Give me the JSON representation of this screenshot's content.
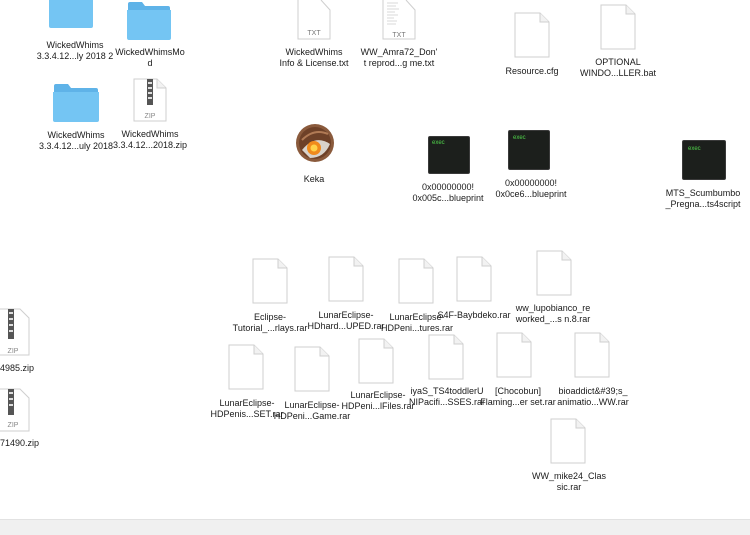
{
  "desktop": {
    "items": [
      {
        "id": "wickedwhims-folder-1",
        "kind": "folder",
        "label": "WickedWhims\n3.3.4.12...ly 2018 2"
      },
      {
        "id": "wickedwhimsmod-folder",
        "kind": "folder",
        "label": "WickedWhimsMo\nd"
      },
      {
        "id": "wickedwhims-folder-2",
        "kind": "folder",
        "label": "WickedWhims\n3.3.4.12...uly 2018"
      },
      {
        "id": "wickedwhims-zip",
        "kind": "zip",
        "badge": "ZIP",
        "label": "WickedWhims\n3.3.4.12...2018.zip"
      },
      {
        "id": "wickedwhims-info-txt",
        "kind": "txt",
        "badge": "TXT",
        "label": "WickedWhims\nInfo & License.txt"
      },
      {
        "id": "ww-amra72-txt",
        "kind": "txt",
        "badge": "TXT",
        "label": "WW_Amra72_Don'\nt reprod...g me.txt"
      },
      {
        "id": "resource-cfg",
        "kind": "doc",
        "label": "Resource.cfg"
      },
      {
        "id": "optional-bat",
        "kind": "doc",
        "label": "OPTIONAL\nWINDO...LLER.bat"
      },
      {
        "id": "keka-app",
        "kind": "app",
        "label": "Keka"
      },
      {
        "id": "blueprint-1",
        "kind": "exec",
        "badge": "exec",
        "label": "0x00000000!\n0x005c...blueprint"
      },
      {
        "id": "blueprint-2",
        "kind": "exec",
        "badge": "exec",
        "label": "0x00000000!\n0x0ce6...blueprint"
      },
      {
        "id": "mts-ts4script",
        "kind": "exec",
        "badge": "exec",
        "label": "MTS_Scumbumbo\n_Pregna...ts4script"
      },
      {
        "id": "zip-4985",
        "kind": "zip",
        "badge": "ZIP",
        "label": "4985.zip"
      },
      {
        "id": "zip-71490",
        "kind": "zip",
        "badge": "ZIP",
        "label": "71490.zip"
      },
      {
        "id": "eclipse-tutorial-rar",
        "kind": "doc",
        "label": "Eclipse-\nTutorial_...rlays.rar"
      },
      {
        "id": "lunar-hdhard-rar",
        "kind": "doc",
        "label": "LunarEclipse-\nHDhard...UPED.rar"
      },
      {
        "id": "lunar-hdpeni-tures-rar",
        "kind": "doc",
        "label": "LunarEclipse-\nHDPeni...tures.rar"
      },
      {
        "id": "s4f-baybdeko-rar",
        "kind": "doc",
        "label": "S4F-Baybdeko.rar"
      },
      {
        "id": "ww-lupobianco-rar",
        "kind": "doc",
        "label": "ww_lupobianco_re\nworked_...s n.8.rar"
      },
      {
        "id": "lunar-hdpenis-set-rar",
        "kind": "doc",
        "label": "LunarEclipse-\nHDPenis...SET.rar"
      },
      {
        "id": "lunar-hdpeni-game-rar",
        "kind": "doc",
        "label": "LunarEclipse-\nHDPeni...Game.rar"
      },
      {
        "id": "lunar-hdpeni-files-rar",
        "kind": "doc",
        "label": "LunarEclipse-\nHDPeni...lFiles.rar"
      },
      {
        "id": "iyas-ts4toddler-rar",
        "kind": "doc",
        "label": "iyaS_TS4toddlerU\nNIPacifi...SSES.rar"
      },
      {
        "id": "chocobun-rar",
        "kind": "doc",
        "label": "[Chocobun]\nFlaming...er set.rar"
      },
      {
        "id": "bioaddict-rar",
        "kind": "doc",
        "label": "bioaddict&#39;s_\nanimatio...WW.rar"
      },
      {
        "id": "ww-mike24-rar",
        "kind": "doc",
        "label": "WW_mike24_Clas\nsic.rar"
      }
    ]
  },
  "colors": {
    "folder_front": "#74c5f3",
    "folder_back": "#5fb3e8",
    "doc_border": "#cfcfcf",
    "exec_bg": "#1c1f1c",
    "exec_text": "#4fd04a"
  }
}
